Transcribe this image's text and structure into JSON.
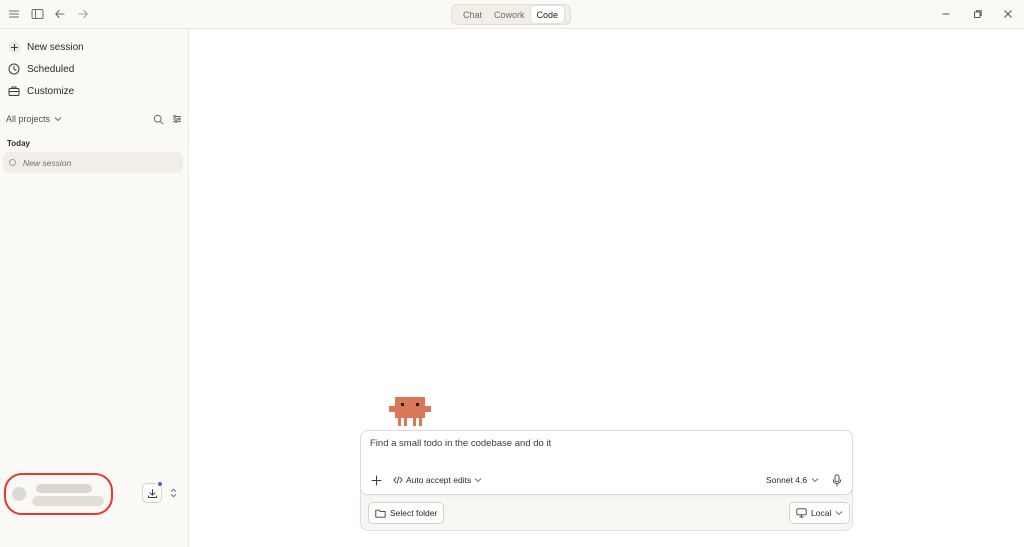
{
  "titlebar": {
    "modes": [
      {
        "label": "Chat",
        "active": false
      },
      {
        "label": "Cowork",
        "active": false
      },
      {
        "label": "Code",
        "active": true
      }
    ],
    "icons": [
      "menu-icon",
      "sidebar-toggle-icon",
      "back-arrow-icon",
      "forward-arrow-icon"
    ],
    "window_controls": [
      "minimize-icon",
      "restore-icon",
      "close-icon"
    ]
  },
  "sidebar": {
    "items": [
      {
        "label": "New session",
        "icon": "plus-icon"
      },
      {
        "label": "Scheduled",
        "icon": "clock-icon"
      },
      {
        "label": "Customize",
        "icon": "briefcase-icon"
      }
    ],
    "projects_filter": "All projects",
    "section_label": "Today",
    "sessions": [
      {
        "label": "New session"
      }
    ]
  },
  "composer": {
    "prompt": "Find a small todo in the codebase and do it",
    "permission_mode": "Auto accept edits",
    "model": "Sonnet 4.6",
    "select_folder": "Select folder",
    "environment": "Local"
  },
  "colors": {
    "accent_mascot": "#d97757",
    "highlight_ring": "#e8372d",
    "notification": "#2e6cd8",
    "sidebar_bg": "#faf9f5"
  }
}
